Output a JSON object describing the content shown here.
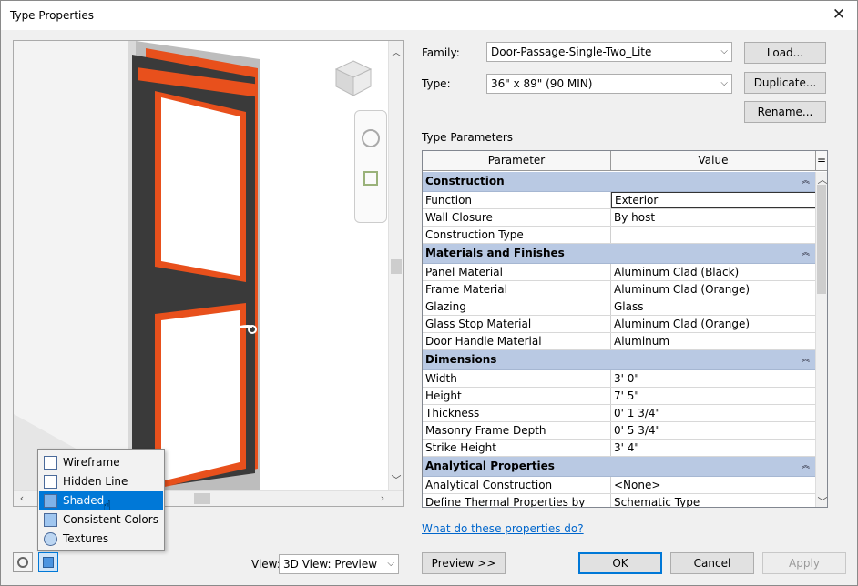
{
  "window": {
    "title": "Type Properties"
  },
  "family": {
    "label": "Family:",
    "value": "Door-Passage-Single-Two_Lite"
  },
  "type": {
    "label": "Type:",
    "value": "36\" x 89\" (90 MIN)"
  },
  "buttons": {
    "load": "Load...",
    "duplicate": "Duplicate...",
    "rename": "Rename...",
    "preview": "Preview >>",
    "ok": "OK",
    "cancel": "Cancel",
    "apply": "Apply"
  },
  "params": {
    "title": "Type Parameters",
    "col_param": "Parameter",
    "col_value": "Value",
    "col_eq": "=",
    "groups": [
      {
        "name": "Construction",
        "rows": [
          {
            "p": "Function",
            "v": "Exterior"
          },
          {
            "p": "Wall Closure",
            "v": "By host"
          },
          {
            "p": "Construction Type",
            "v": ""
          }
        ]
      },
      {
        "name": "Materials and Finishes",
        "rows": [
          {
            "p": "Panel Material",
            "v": "Aluminum Clad (Black)"
          },
          {
            "p": "Frame Material",
            "v": "Aluminum Clad (Orange)"
          },
          {
            "p": "Glazing",
            "v": "Glass"
          },
          {
            "p": "Glass Stop Material",
            "v": "Aluminum Clad (Orange)"
          },
          {
            "p": "Door Handle Material",
            "v": "Aluminum"
          }
        ]
      },
      {
        "name": "Dimensions",
        "rows": [
          {
            "p": "Width",
            "v": "3'  0\""
          },
          {
            "p": "Height",
            "v": "7'  5\""
          },
          {
            "p": "Thickness",
            "v": "0'  1 3/4\""
          },
          {
            "p": "Masonry Frame Depth",
            "v": "0'  5 3/4\""
          },
          {
            "p": "Strike Height",
            "v": "3'  4\""
          }
        ]
      },
      {
        "name": "Analytical Properties",
        "rows": [
          {
            "p": "Analytical Construction",
            "v": "<None>"
          },
          {
            "p": "Define Thermal Properties by",
            "v": "Schematic Type"
          }
        ]
      }
    ]
  },
  "help_link": "What do these properties do?",
  "view": {
    "label": "View:",
    "value": "3D View: Preview"
  },
  "style_menu": [
    "Wireframe",
    "Hidden Line",
    "Shaded",
    "Consistent Colors",
    "Textures"
  ],
  "style_selected": "Shaded",
  "colors": {
    "frame": "#e8501c",
    "panel": "#3a3a3a",
    "accent": "#0078d7",
    "group_header": "#b9c9e3"
  }
}
